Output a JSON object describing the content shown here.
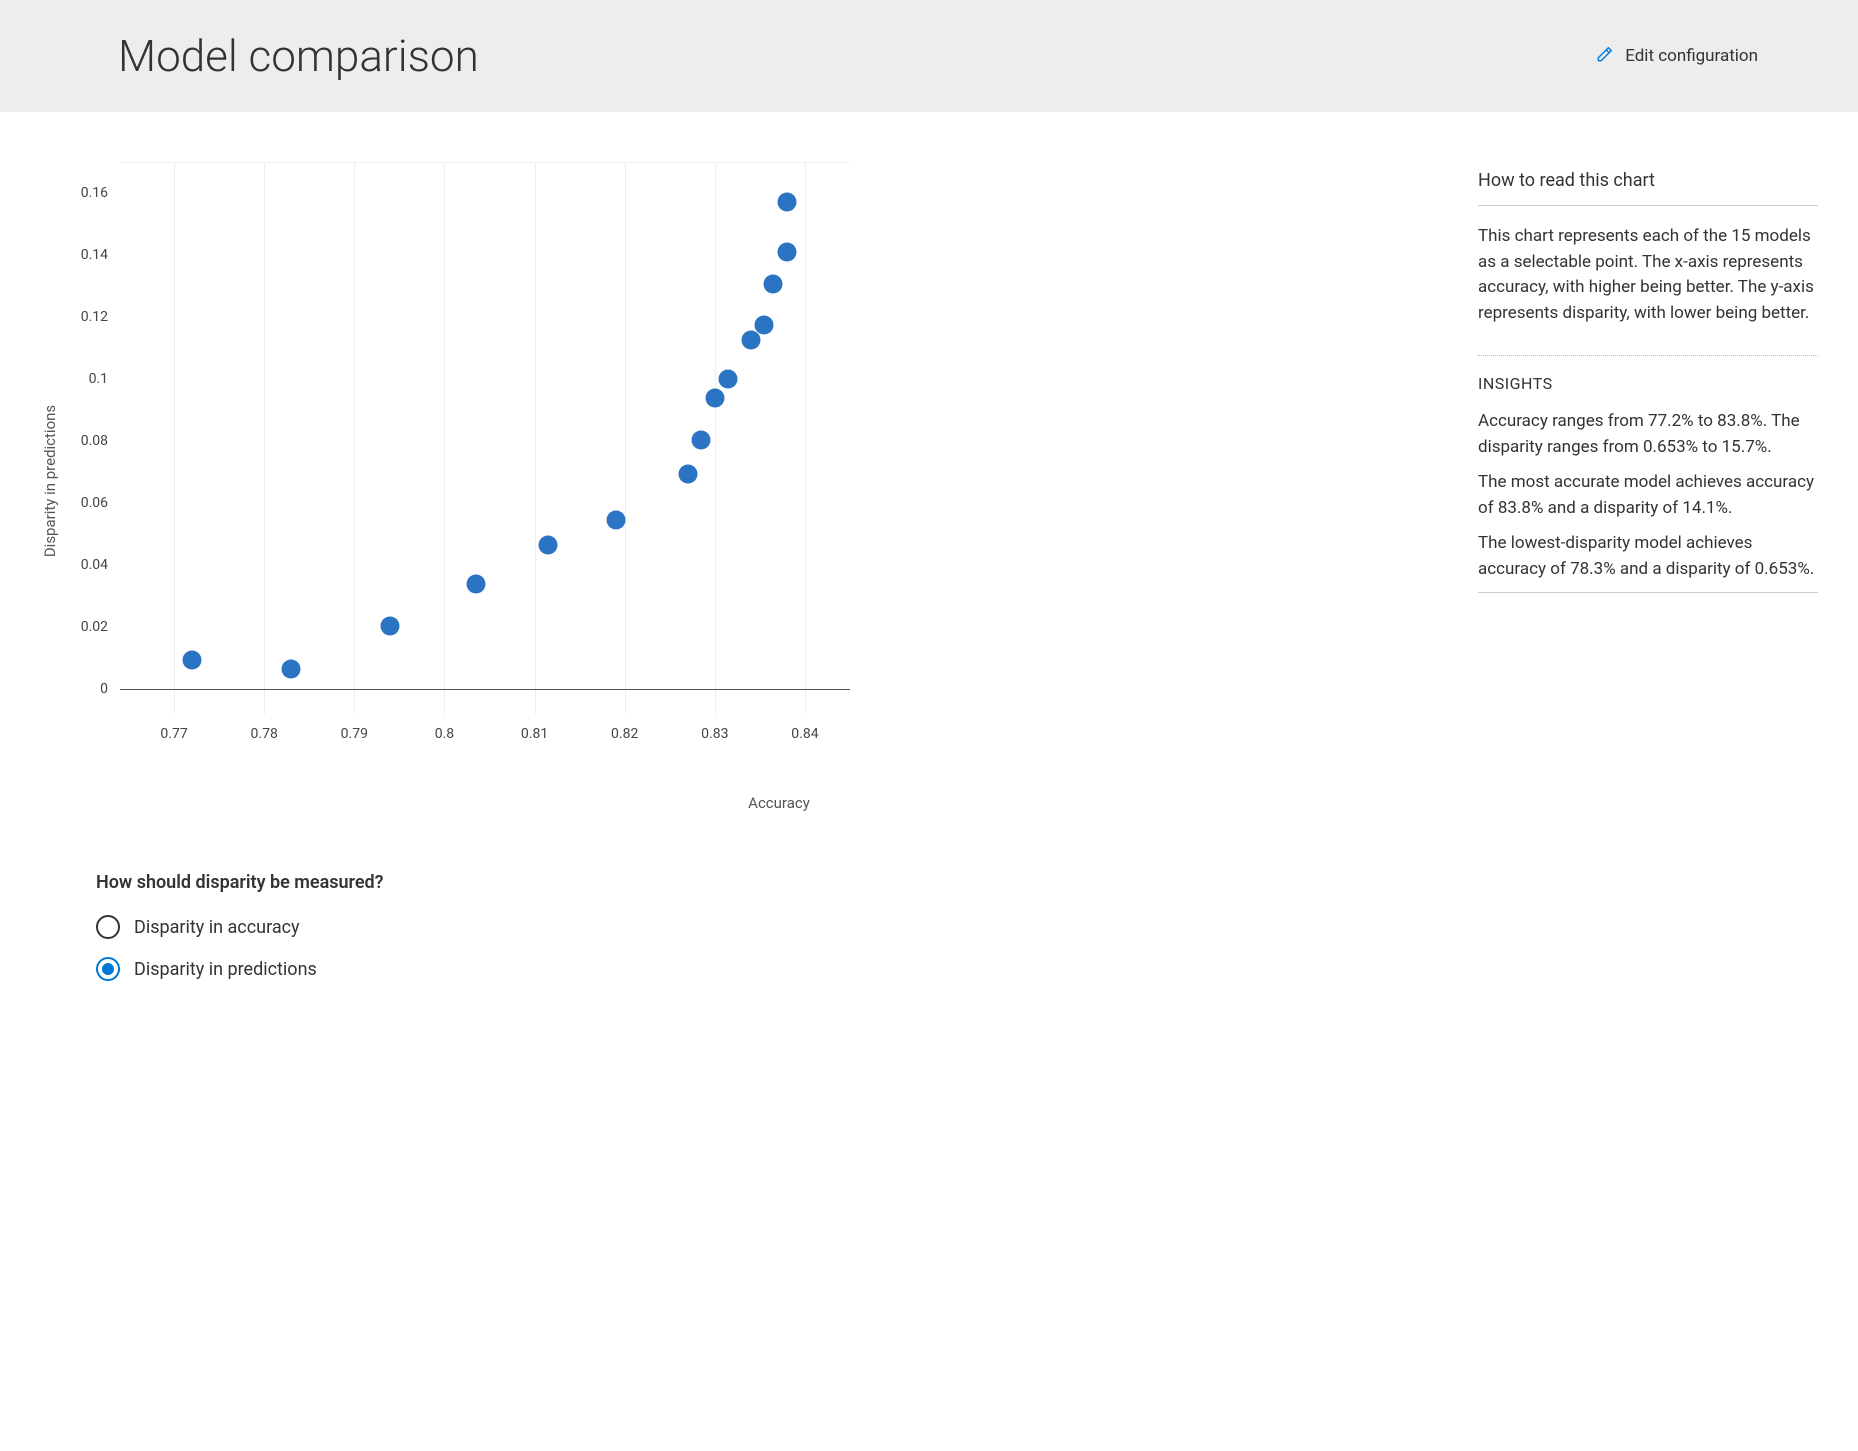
{
  "header": {
    "title": "Model comparison",
    "edit_label": "Edit configuration"
  },
  "chart_data": {
    "type": "scatter",
    "title": "",
    "xlabel": "Accuracy",
    "ylabel": "Disparity in predictions",
    "xlim": [
      0.764,
      0.845
    ],
    "ylim": [
      -0.008,
      0.17
    ],
    "xticks": [
      0.77,
      0.78,
      0.79,
      0.8,
      0.81,
      0.82,
      0.83,
      0.84
    ],
    "yticks": [
      0,
      0.02,
      0.04,
      0.06,
      0.08,
      0.1,
      0.12,
      0.14,
      0.16
    ],
    "points": [
      {
        "x": 0.772,
        "y": 0.0095
      },
      {
        "x": 0.783,
        "y": 0.00653
      },
      {
        "x": 0.794,
        "y": 0.0205
      },
      {
        "x": 0.8035,
        "y": 0.034
      },
      {
        "x": 0.8115,
        "y": 0.0465
      },
      {
        "x": 0.819,
        "y": 0.0545
      },
      {
        "x": 0.827,
        "y": 0.0695
      },
      {
        "x": 0.8285,
        "y": 0.0805
      },
      {
        "x": 0.83,
        "y": 0.094
      },
      {
        "x": 0.8315,
        "y": 0.1
      },
      {
        "x": 0.834,
        "y": 0.1125
      },
      {
        "x": 0.8355,
        "y": 0.1175
      },
      {
        "x": 0.8365,
        "y": 0.1305
      },
      {
        "x": 0.838,
        "y": 0.141
      },
      {
        "x": 0.838,
        "y": 0.157
      }
    ]
  },
  "right": {
    "howto_title": "How to read this chart",
    "howto_text": "This chart represents each of the 15 models as a selectable point. The x-axis represents accuracy, with higher being better. The y-axis represents disparity, with lower being better.",
    "insights_label": "INSIGHTS",
    "insight1": "Accuracy ranges from 77.2% to 83.8%. The disparity ranges from 0.653% to 15.7%.",
    "insight2": "The most accurate model achieves accuracy of 83.8% and a disparity of 14.1%.",
    "insight3": "The lowest-disparity model achieves accuracy of 78.3% and a disparity of 0.653%."
  },
  "question": {
    "title": "How should disparity be measured?",
    "opt1": "Disparity in accuracy",
    "opt2": "Disparity in predictions",
    "selected": 2
  }
}
